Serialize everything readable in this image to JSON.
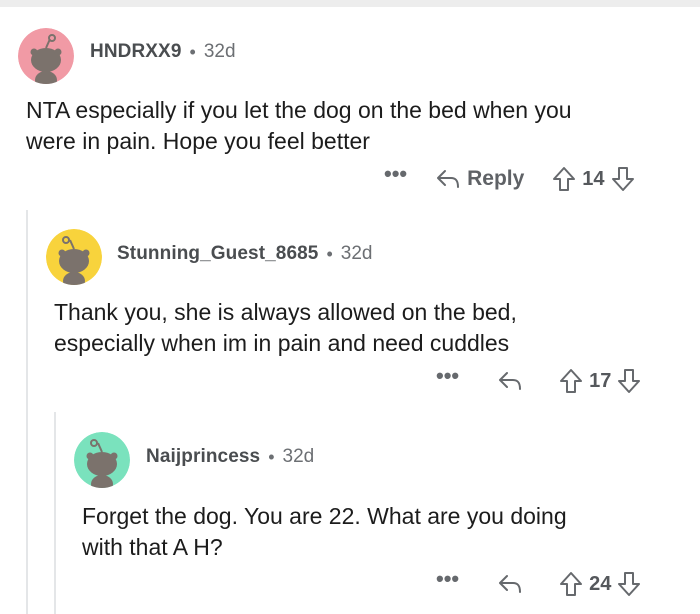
{
  "comments": [
    {
      "username": "HNDRXX9",
      "separator": "•",
      "age": "32d",
      "body_line1": "NTA especially if you let the dog on the bed when you",
      "body_line2": "were in pain. Hope you feel better",
      "more_label": "•••",
      "reply_label": "Reply",
      "vote_count": "14",
      "avatar_color": "#f19aa5"
    },
    {
      "username": "Stunning_Guest_8685",
      "separator": "•",
      "age": "32d",
      "body_line1": "Thank you, she is always allowed on the bed,",
      "body_line2": "especially when im in pain and need cuddles",
      "more_label": "•••",
      "vote_count": "17",
      "avatar_color": "#f8d33c"
    },
    {
      "username": "Naijprincess",
      "separator": "•",
      "age": "32d",
      "body_line1": "Forget the dog. You are 22. What are you doing",
      "body_line2": "with that A H?",
      "more_label": "•••",
      "vote_count": "24",
      "avatar_color": "#7ae2bd"
    }
  ],
  "colors": {
    "text": "#1c1c1c",
    "meta": "#6c6f73",
    "thread_line": "#e4e6e8",
    "snoo_body": "#7b726c"
  },
  "icons": [
    "snoo-avatar-icon",
    "more-icon",
    "reply-arrow-icon",
    "upvote-icon",
    "downvote-icon"
  ]
}
